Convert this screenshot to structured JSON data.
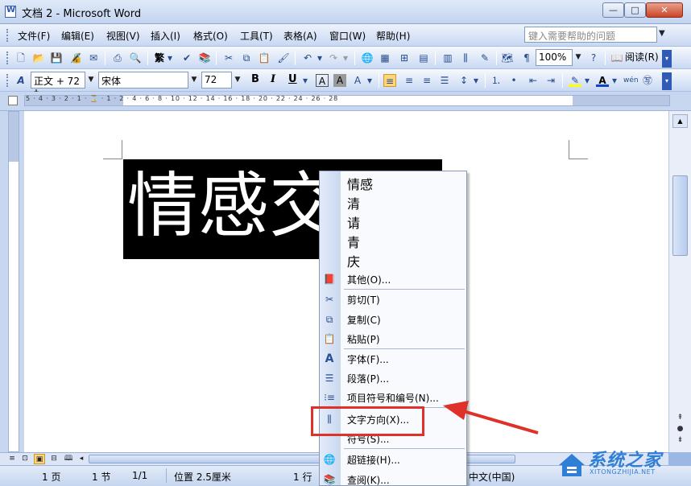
{
  "window": {
    "title": "文档 2 - Microsoft Word",
    "min_glyph": "—",
    "max_glyph": "□",
    "close_glyph": "✕"
  },
  "menubar": {
    "items": [
      "文件(F)",
      "编辑(E)",
      "视图(V)",
      "插入(I)",
      "格式(O)",
      "工具(T)",
      "表格(A)",
      "窗口(W)",
      "帮助(H)"
    ],
    "help_placeholder": "键入需要帮助的问题"
  },
  "toolbar_standard": {
    "zoom": "100%",
    "read_label": "阅读(R)",
    "traditional_label": "繁"
  },
  "toolbar_format": {
    "style": "正文 + 72 ‡",
    "font": "宋体",
    "size": "72"
  },
  "ruler": {
    "numbers": "5 · 4 · 3 · 2 · 1 · ⌛ · 1 · 2 · 4 · 6 · 8 · 10 · 12 · 14 · 16 · 18 · 20 · 22 · 24 · 26 · 28"
  },
  "document": {
    "text": "情感交流"
  },
  "context_menu": {
    "items": [
      {
        "label": "情感",
        "icon": ""
      },
      {
        "label": "清",
        "icon": ""
      },
      {
        "label": "请",
        "icon": ""
      },
      {
        "label": "青",
        "icon": ""
      },
      {
        "label": "庆",
        "icon": ""
      },
      {
        "label": "其他(O)...",
        "icon": "book-icon"
      },
      {
        "label": "剪切(T)",
        "icon": "scissors-icon"
      },
      {
        "label": "复制(C)",
        "icon": "copy-icon"
      },
      {
        "label": "粘贴(P)",
        "icon": "paste-icon"
      },
      {
        "label": "字体(F)...",
        "icon": "font-icon"
      },
      {
        "label": "段落(P)...",
        "icon": "paragraph-icon"
      },
      {
        "label": "项目符号和编号(N)...",
        "icon": "list-icon"
      },
      {
        "label": "文字方向(X)...",
        "icon": "text-direction-icon"
      },
      {
        "label": "符号(S)...",
        "icon": ""
      },
      {
        "label": "超链接(H)...",
        "icon": "hyperlink-icon"
      },
      {
        "label": "查阅(K)...",
        "icon": "lookup-icon"
      }
    ]
  },
  "statusbar": {
    "page": "1 页",
    "section": "1 节",
    "pages": "1/1",
    "position": "位置 2.5厘米",
    "line": "1 行",
    "language": "中文(中国)"
  },
  "watermark": {
    "main": "系统之家",
    "sub": "XITONGZHIJIA.NET"
  },
  "colors": {
    "highlight_box": "#e0302a",
    "accent": "#2f5bb7"
  }
}
